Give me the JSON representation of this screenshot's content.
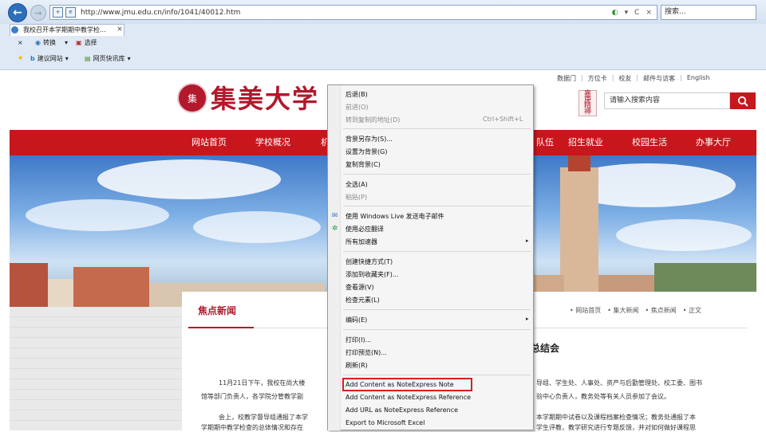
{
  "browser": {
    "url": "http://www.jmu.edu.cn/info/1041/40012.htm",
    "search_placeholder": "搜索...",
    "tab_title": "我校召开本学期期中教学检...",
    "tab_close": "×",
    "toolbar1": {
      "close": "×",
      "convert": "转换",
      "select": "选择"
    },
    "toolbar2": {
      "suggested_sites": "建议网站",
      "web_slices": "网页快讯库"
    },
    "addr_right": [
      "C",
      "▾",
      "×",
      "▾"
    ]
  },
  "site": {
    "top_links": [
      "数据门",
      "方位卡",
      "校友",
      "邮件与访客",
      "English"
    ],
    "logo_seal_text": "集",
    "logo_text": "集美大学",
    "stamp_text": "嘉庚精神",
    "search_placeholder": "请输入搜索内容",
    "nav_items": [
      "网站首页",
      "学校概况",
      "机",
      "队伍",
      "招生就业",
      "校园生活",
      "办事大厅"
    ]
  },
  "content": {
    "section_title": "焦点新闻",
    "breadcrumb": [
      "• 网站首页",
      "• 集大新闻",
      "• 焦点新闻",
      "• 正文"
    ],
    "article_title_fragment": "总结会",
    "para1_left": "11月21日下午，我校在尚大楼",
    "para1_right": "导组、学生处、人事处、资产与后勤管理处、校工委、图书",
    "para2_left": "馆等部门负责人，各学院分管教学副",
    "para2_right": "验中心负责人，教务处等有关人员参加了会议。",
    "para3_left": "会上，校教学督导组通报了本学",
    "para3_right": "本学期期中试卷以及课程档案检查情况；教务处通报了本",
    "para4_left": "学期期中教学检查的总体情况和存在",
    "para4_right": "学生评教，教学研究进行专题反馈，并对如何做好课程思"
  },
  "context_menu": {
    "items": [
      {
        "label": "后退(B)",
        "disabled": false
      },
      {
        "label": "前进(O)",
        "disabled": true
      },
      {
        "label": "转到复制的地址(D)",
        "disabled": true,
        "shortcut": "Ctrl+Shift+L"
      },
      {
        "label": "背景另存为(S)...",
        "disabled": false
      },
      {
        "label": "设置为背景(G)",
        "disabled": false
      },
      {
        "label": "复制背景(C)",
        "disabled": false
      },
      {
        "label": "全选(A)",
        "disabled": false
      },
      {
        "label": "粘贴(P)",
        "disabled": true
      },
      {
        "label": "使用 Windows Live 发送电子邮件",
        "disabled": false
      },
      {
        "label": "使用必应翻译",
        "disabled": false
      },
      {
        "label": "所有加速器",
        "disabled": false
      },
      {
        "label": "创建快捷方式(T)",
        "disabled": false
      },
      {
        "label": "添加到收藏夹(F)...",
        "disabled": false
      },
      {
        "label": "查看源(V)",
        "disabled": false
      },
      {
        "label": "检查元素(L)",
        "disabled": false
      },
      {
        "label": "编码(E)",
        "disabled": false
      },
      {
        "label": "打印(I)...",
        "disabled": false
      },
      {
        "label": "打印预览(N)...",
        "disabled": false
      },
      {
        "label": "刷新(R)",
        "disabled": false
      },
      {
        "label": "Add Content as NoteExpress Note",
        "disabled": false
      },
      {
        "label": "Add Content as NoteExpress Reference",
        "disabled": false
      },
      {
        "label": "Add URL as NoteExpress Reference",
        "disabled": false
      },
      {
        "label": "Export to Microsoft Excel",
        "disabled": false
      }
    ],
    "submenu_arrow": "▸"
  },
  "colors": {
    "brand_red": "#c8161d",
    "highlight": "#d42020"
  }
}
